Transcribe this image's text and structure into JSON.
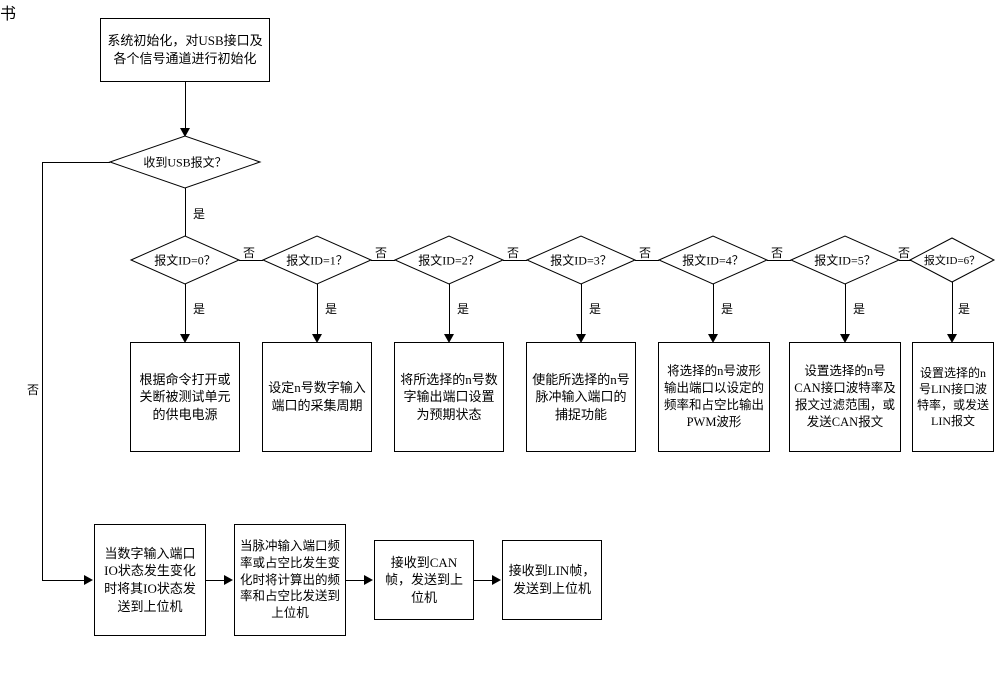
{
  "chart_data": {
    "type": "flowchart",
    "title": "",
    "nodes": [
      {
        "id": "init",
        "type": "process",
        "text": "系统初始化，对USB接口及各个信号通道进行初始化"
      },
      {
        "id": "d_usb",
        "type": "decision",
        "text": "收到USB报文？"
      },
      {
        "id": "d0",
        "type": "decision",
        "text": "报文ID=0？"
      },
      {
        "id": "d1",
        "type": "decision",
        "text": "报文ID=1？"
      },
      {
        "id": "d2",
        "type": "decision",
        "text": "报文ID=2？"
      },
      {
        "id": "d3",
        "type": "decision",
        "text": "报文ID=3？"
      },
      {
        "id": "d4",
        "type": "decision",
        "text": "报文ID=4？"
      },
      {
        "id": "d5",
        "type": "decision",
        "text": "报文ID=5？"
      },
      {
        "id": "d6",
        "type": "decision",
        "text": "报文ID=6？"
      },
      {
        "id": "a0",
        "type": "process",
        "text": "根据命令打开或关断被测试单元的供电电源"
      },
      {
        "id": "a1",
        "type": "process",
        "text": "设定n号数字输入端口的采集周期"
      },
      {
        "id": "a2",
        "type": "process",
        "text": "将所选择的n号数字输出端口设置为预期状态"
      },
      {
        "id": "a3",
        "type": "process",
        "text": "使能所选择的n号脉冲输入端口的捕捉功能"
      },
      {
        "id": "a4",
        "type": "process",
        "text": "将选择的n号波形输出端口以设定的频率和占空比输出PWM波形"
      },
      {
        "id": "a5",
        "type": "process",
        "text": "设置选择的n号CAN接口波特率及报文过滤范围，或发送CAN报文"
      },
      {
        "id": "a6",
        "type": "process",
        "text": "设置选择的n号LIN接口波特率，或发送LIN报文"
      },
      {
        "id": "m0",
        "type": "process",
        "text": "当数字输入端口IO状态发生变化时将其IO状态发送到上位机"
      },
      {
        "id": "m1",
        "type": "process",
        "text": "当脉冲输入端口频率或占空比发生变化时将计算出的频率和占空比发送到上位机"
      },
      {
        "id": "m2",
        "type": "process",
        "text": "接收到CAN帧，发送到上位机"
      },
      {
        "id": "m3",
        "type": "process",
        "text": "接收到LIN帧，发送到上位机"
      }
    ],
    "labels": {
      "yes": "是",
      "no": "否"
    }
  }
}
